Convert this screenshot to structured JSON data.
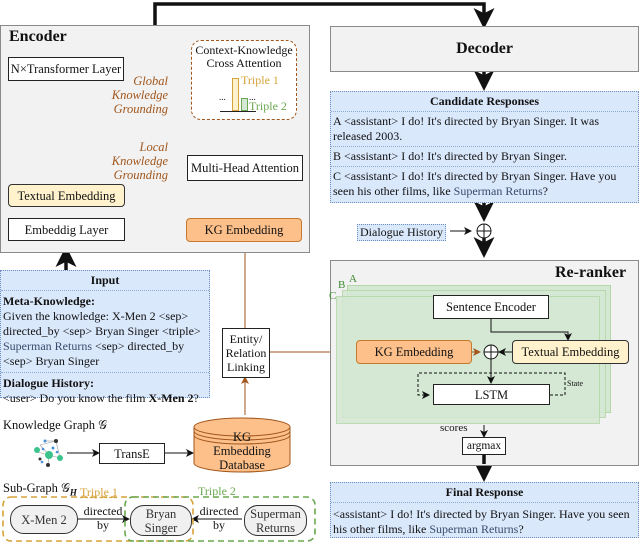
{
  "encoder": {
    "title": "Encoder",
    "transformer_layer": "N×Transformer Layer",
    "cross_attention_title": "Context-Knowledge Cross Attention",
    "triple1_label": "Triple 1",
    "triple2_label": "Triple 2",
    "ellipsis": "...",
    "global_grounding": "Global Knowledge Grounding",
    "local_grounding": "Local Knowledge Grounding",
    "multi_head_attention": "Multi-Head Attention",
    "textual_embedding": "Textual Embedding",
    "embedding_layer": "Embeddig Layer",
    "kg_embedding": "KG Embedding"
  },
  "decoder": {
    "title": "Decoder"
  },
  "candidates": {
    "title": "Candidate Responses",
    "items": [
      {
        "prefix": "A <assistant> I do! It's directed by Bryan Singer. It was released 2003.",
        "highlight": "",
        "suffix": ""
      },
      {
        "prefix": "B <assistant> I do! It's directed by Bryan Singer.",
        "highlight": "",
        "suffix": ""
      },
      {
        "prefix": "C <assistant> I do! It's directed by Bryan Singer. Have you seen his other films, like ",
        "highlight": "Superman Returns",
        "suffix": "?"
      }
    ]
  },
  "dialogue_history_tag": "Dialogue History",
  "reranker": {
    "title": "Re-ranker",
    "layer_labels": [
      "A",
      "B",
      "C"
    ],
    "sentence_encoder": "Sentence Encoder",
    "kg_embedding": "KG Embedding",
    "textual_embedding": "Textual Embedding",
    "lstm": "LSTM",
    "state": "State",
    "scores": "scores",
    "argmax": "argmax"
  },
  "final_response": {
    "title": "Final Response",
    "prefix": "<assistant> I do! It's directed by Bryan Singer. Have you seen his other films, like ",
    "highlight": "Superman Returns",
    "suffix": "?"
  },
  "input": {
    "title": "Input",
    "meta_title": "Meta-Knowledge:",
    "meta_text_1": "Given the knowledge: X-Men 2 <sep> directed_by <sep> Bryan Singer <triple> ",
    "meta_text_2": "Superman Returns",
    "meta_text_3": " <sep> directed_by <sep> Bryan Singer",
    "history_title": "Dialogue History:",
    "history_prefix": "<user> Do you know the film ",
    "history_bold": "X-Men 2",
    "history_suffix": "?"
  },
  "linking": "Entity/ Relation Linking",
  "knowledge_graph_label": "Knowledge Graph 𝒢",
  "transe": "TransE",
  "kg_database": "KG Embedding Database",
  "subgraph": {
    "label": "Sub-Graph 𝒢",
    "label_sub": "H",
    "triple1": "Triple 1",
    "triple2": "Triple 2",
    "node1": "X-Men 2",
    "edge1": "directed by",
    "node2": "Bryan Singer",
    "edge2": "directed by",
    "node3": "Superman Returns"
  },
  "colors": {
    "orange_arrow": "#a0561c",
    "kg_fill": "#fdc08a",
    "text_fill": "#fff2cc",
    "blue_fill": "#dae8fc",
    "green_layer": "#d5e8d4",
    "triple1": "#d6a23a",
    "triple2": "#6aa84f"
  }
}
